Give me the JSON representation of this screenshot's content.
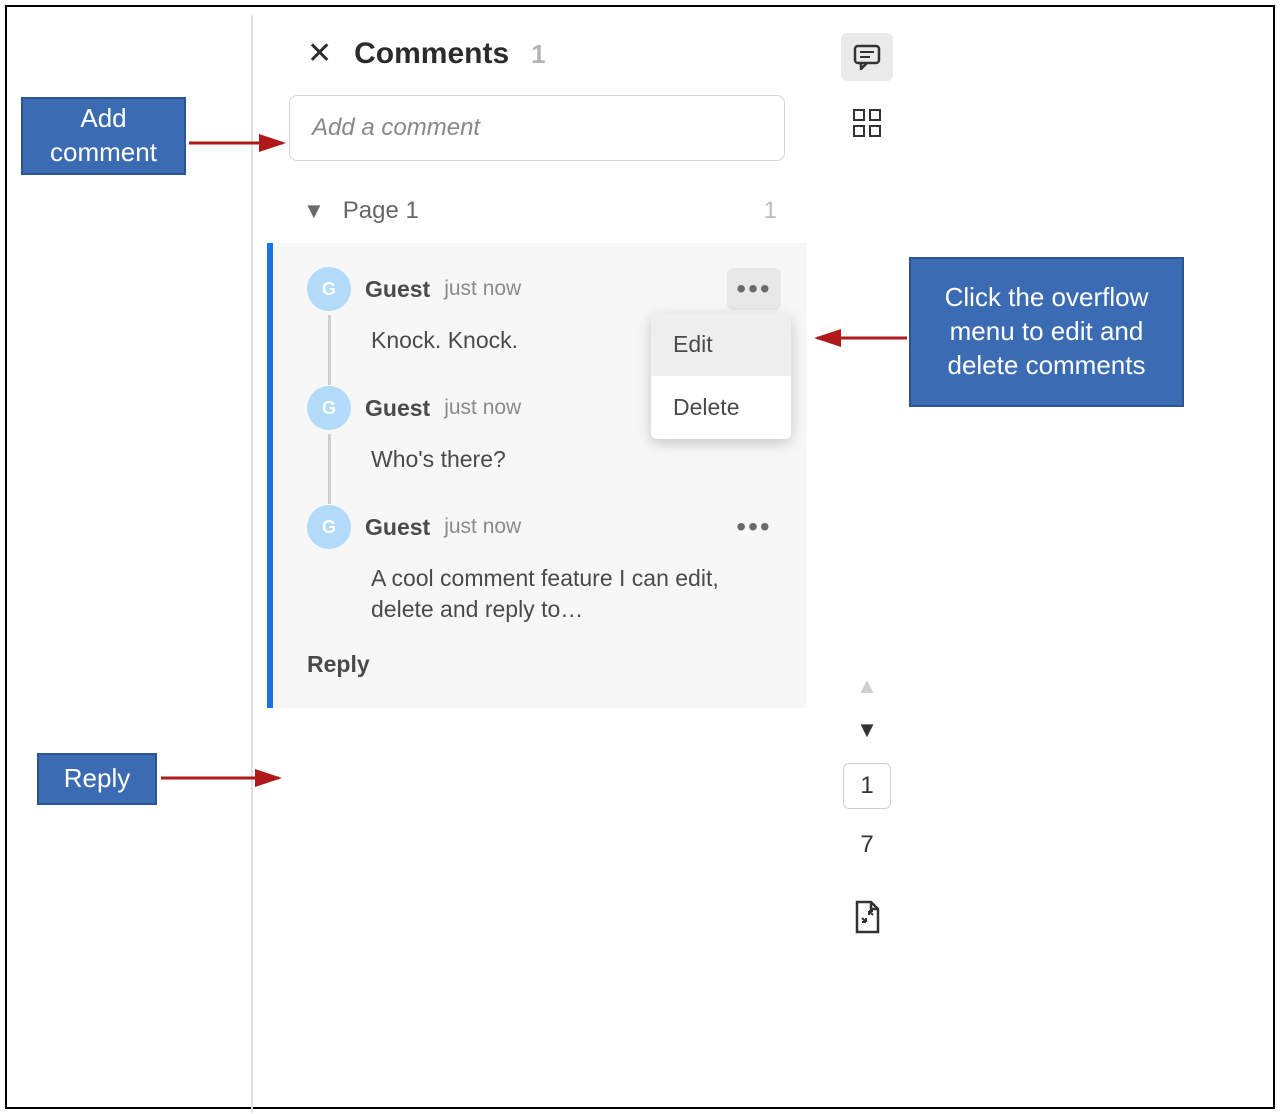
{
  "header": {
    "title": "Comments",
    "count": "1"
  },
  "add_comment": {
    "placeholder": "Add a comment"
  },
  "page_section": {
    "label": "Page 1",
    "count": "1"
  },
  "messages": [
    {
      "avatar": "G",
      "author": "Guest",
      "time": "just now",
      "body": "Knock. Knock."
    },
    {
      "avatar": "G",
      "author": "Guest",
      "time": "just now",
      "body": "Who's there?"
    },
    {
      "avatar": "G",
      "author": "Guest",
      "time": "just now",
      "body": "A cool comment feature I can edit, delete and reply to…"
    }
  ],
  "reply_label": "Reply",
  "overflow_menu": {
    "edit": "Edit",
    "delete": "Delete"
  },
  "rail": {
    "current_page": "1",
    "total_pages": "7"
  },
  "callouts": {
    "add_comment": "Add comment",
    "overflow": "Click the overflow menu to edit and delete comments",
    "reply": "Reply"
  }
}
